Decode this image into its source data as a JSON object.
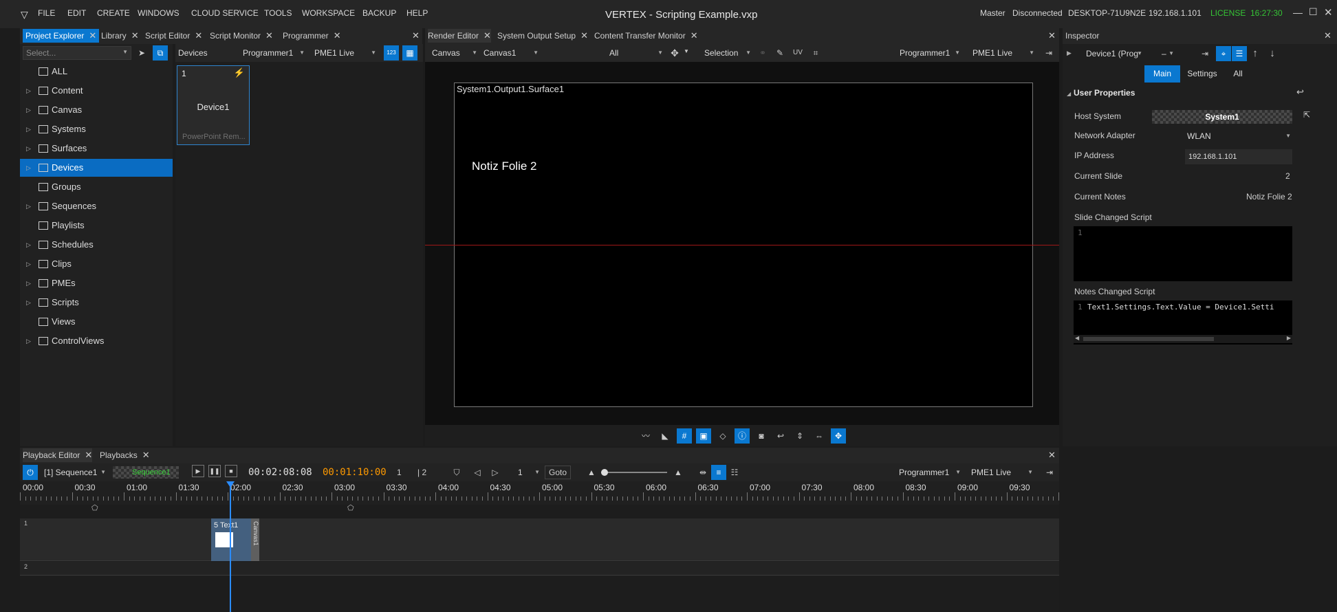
{
  "app": {
    "title": "VERTEX - Scripting Example.vxp",
    "menu": [
      "FILE",
      "EDIT",
      "CREATE",
      "WINDOWS",
      "CLOUD SERVICE",
      "TOOLS",
      "WORKSPACE",
      "BACKUP",
      "HELP"
    ],
    "status": {
      "role": "Master",
      "connection": "Disconnected",
      "host": "DESKTOP-71U9N2E",
      "ip": "192.168.1.101",
      "license": "LICENSE",
      "time": "16:27:30"
    },
    "colors": {
      "accent": "#0a78d0",
      "license": "#35c435",
      "timecode_orange": "#ff9a00",
      "playhead": "#2a8cff"
    }
  },
  "left_tabs": [
    "Project Explorer",
    "Library",
    "Script Editor",
    "Script Monitor",
    "Programmer"
  ],
  "explorer": {
    "search_placeholder": "Select...",
    "items": [
      {
        "label": "ALL",
        "icon": "database-icon",
        "expandable": false
      },
      {
        "label": "Content",
        "icon": "folder-icon",
        "expandable": true
      },
      {
        "label": "Canvas",
        "icon": "canvas-icon",
        "expandable": true
      },
      {
        "label": "Systems",
        "icon": "server-icon",
        "expandable": true
      },
      {
        "label": "Surfaces",
        "icon": "surface-icon",
        "expandable": true
      },
      {
        "label": "Devices",
        "icon": "plug-icon",
        "expandable": true,
        "selected": true
      },
      {
        "label": "Groups",
        "icon": "group-icon",
        "expandable": false
      },
      {
        "label": "Sequences",
        "icon": "sequence-icon",
        "expandable": true
      },
      {
        "label": "Playlists",
        "icon": "playlist-icon",
        "expandable": false
      },
      {
        "label": "Schedules",
        "icon": "calendar-icon",
        "expandable": true
      },
      {
        "label": "Clips",
        "icon": "clip-icon",
        "expandable": true
      },
      {
        "label": "PMEs",
        "icon": "pme-icon",
        "expandable": true
      },
      {
        "label": "Scripts",
        "icon": "code-icon",
        "expandable": true
      },
      {
        "label": "Views",
        "icon": "views-icon",
        "expandable": false
      },
      {
        "label": "ControlViews",
        "icon": "sliders-icon",
        "expandable": true
      }
    ]
  },
  "devices_panel": {
    "title": "Devices",
    "programmer": "Programmer1",
    "pme": "PME1 Live",
    "card": {
      "number": "1",
      "name": "Device1",
      "type": "PowerPoint Rem..."
    }
  },
  "center_tabs": [
    "Render Editor",
    "System Output Setup",
    "Content Transfer Monitor"
  ],
  "render_editor": {
    "canvas_dd": "Canvas",
    "canvas1_dd": "Canvas1",
    "filter_dd": "All",
    "mode_dd": "Selection",
    "programmer": "Programmer1",
    "pme": "PME1 Live",
    "surface_label": "System1.Output1.Surface1",
    "note_text": "Notiz Folie 2"
  },
  "inspector": {
    "tab": "Inspector",
    "device_dd": "Device1 (Prog",
    "dash_dd": "–",
    "subtabs": [
      "Main",
      "Settings",
      "All"
    ],
    "section": "User Properties",
    "fields": {
      "host_system_label": "Host System",
      "host_system": "System1",
      "network_adapter_label": "Network Adapter",
      "network_adapter": "WLAN",
      "ip_label": "IP Address",
      "ip": "192.168.1.101",
      "current_slide_label": "Current Slide",
      "current_slide": "2",
      "current_notes_label": "Current Notes",
      "current_notes": "Notiz Folie 2",
      "slide_script_label": "Slide Changed Script",
      "slide_script_line": "1",
      "notes_script_label": "Notes Changed Script",
      "notes_script_line": "1",
      "notes_script_code": "Text1.Settings.Text.Value = Device1.Setti"
    }
  },
  "playback": {
    "tabs": [
      "Playback Editor",
      "Playbacks"
    ],
    "sequence_dd": "[1] Sequence1",
    "sequence_chip": "Sequence1",
    "timecode": "00:02:08:08",
    "countdown": "00:01:10:00",
    "page_current": "1",
    "page_total": "| 2",
    "speed_dd": "1",
    "goto": "Goto",
    "programmer": "Programmer1",
    "pme": "PME1 Live",
    "ruler": [
      "00:00",
      "00:30",
      "01:00",
      "01:30",
      "02:00",
      "02:30",
      "03:00",
      "03:30",
      "04:00",
      "04:30",
      "05:00",
      "05:30",
      "06:00",
      "06:30",
      "07:00",
      "07:30",
      "08:00",
      "08:30",
      "09:00",
      "09:30"
    ],
    "tracks": [
      "1",
      "2"
    ],
    "clip": {
      "label": "5 Text1",
      "side_label": "Canvas1"
    }
  }
}
